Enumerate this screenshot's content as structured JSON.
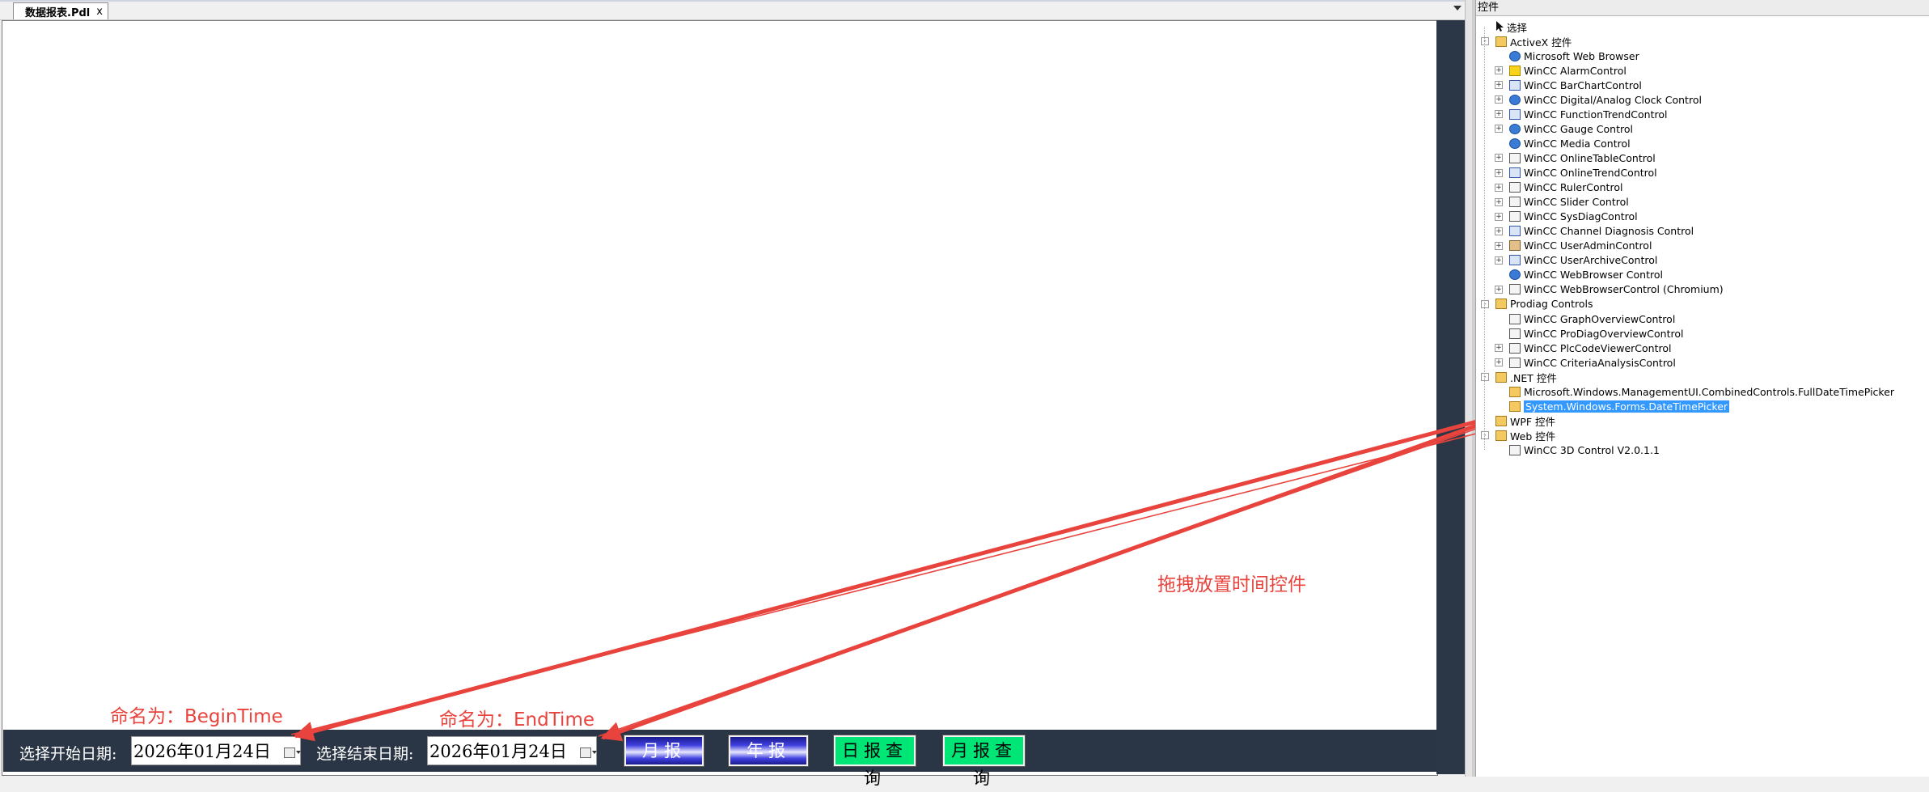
{
  "tab": {
    "title": "数据报表.Pdl",
    "close": "x"
  },
  "toolbar": {
    "begin_label": "选择开始日期:",
    "begin_value": "2026年01月24日",
    "end_label": "选择结束日期:",
    "end_value": "2026年01月24日",
    "btn_month": "月报",
    "btn_year": "年报",
    "btn_day_query": "日报查询",
    "btn_month_query": "月报查询"
  },
  "annotations": {
    "begin_name": "命名为：BeginTime",
    "end_name": "命名为：EndTime",
    "drag_hint": "拖拽放置时间控件",
    "arrow_color": "#e8433d"
  },
  "panel": {
    "title": "控件",
    "select": "选择",
    "groups": [
      {
        "label": "ActiveX 控件",
        "items": [
          "Microsoft Web Browser",
          "WinCC AlarmControl",
          "WinCC BarChartControl",
          "WinCC Digital/Analog Clock Control",
          "WinCC FunctionTrendControl",
          "WinCC Gauge Control",
          "WinCC Media Control",
          "WinCC OnlineTableControl",
          "WinCC OnlineTrendControl",
          "WinCC RulerControl",
          "WinCC Slider Control",
          "WinCC SysDiagControl",
          "WinCC Channel Diagnosis Control",
          "WinCC UserAdminControl",
          "WinCC UserArchiveControl",
          "WinCC WebBrowser Control",
          "WinCC WebBrowserControl (Chromium)"
        ]
      },
      {
        "label": "Prodiag Controls",
        "items": [
          "WinCC GraphOverviewControl",
          "WinCC ProDiagOverviewControl",
          "WinCC PlcCodeViewerControl",
          "WinCC CriteriaAnalysisControl"
        ]
      },
      {
        "label": ".NET 控件",
        "items": [
          "Microsoft.Windows.ManagementUI.CombinedControls.FullDateTimePicker",
          "System.Windows.Forms.DateTimePicker"
        ]
      },
      {
        "label": "WPF 控件",
        "items": []
      },
      {
        "label": "Web 控件",
        "items": [
          "WinCC 3D Control V2.0.1.1"
        ]
      }
    ]
  }
}
